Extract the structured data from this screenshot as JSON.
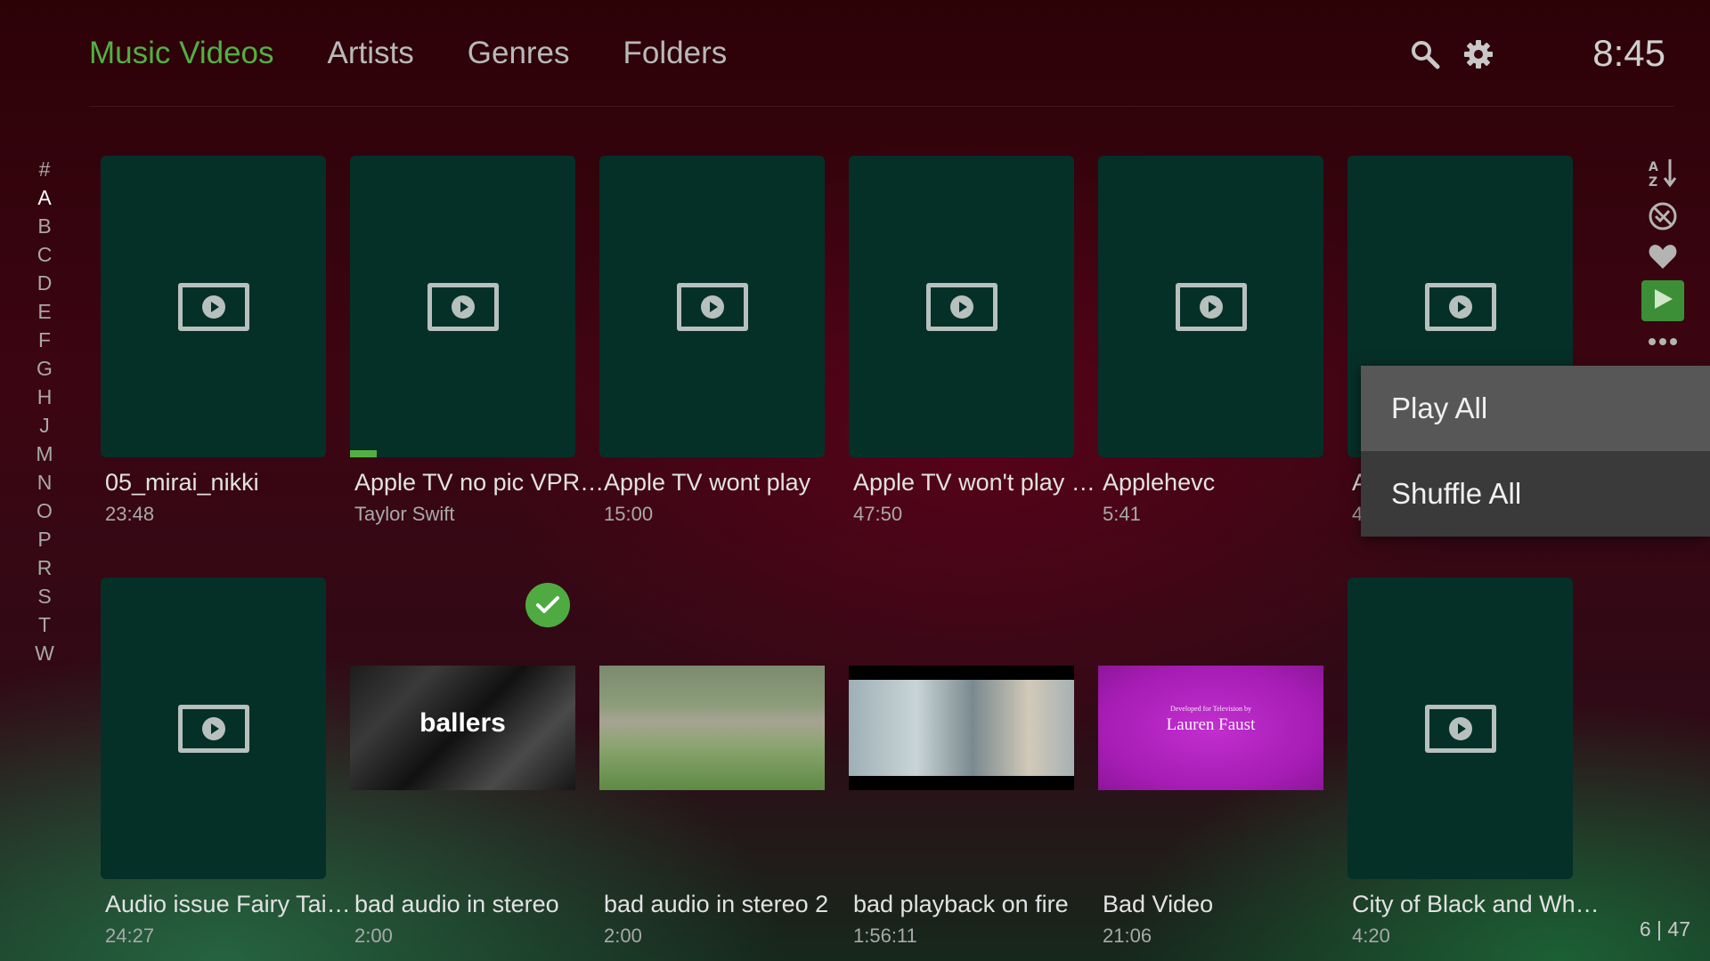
{
  "nav": {
    "tabs": [
      {
        "label": "Music Videos",
        "active": true
      },
      {
        "label": "Artists"
      },
      {
        "label": "Genres"
      },
      {
        "label": "Folders"
      }
    ]
  },
  "header": {
    "clock": "8:45"
  },
  "alphabet": [
    "#",
    "A",
    "B",
    "C",
    "D",
    "E",
    "F",
    "G",
    "H",
    "J",
    "M",
    "N",
    "O",
    "P",
    "R",
    "S",
    "T",
    "W"
  ],
  "alphabet_current": "A",
  "videos": [
    {
      "title": "05_mirai_nikki",
      "subtitle": "23:48"
    },
    {
      "title": "Apple TV no pic VPR…",
      "subtitle": "Taylor Swift",
      "progress": 0.12
    },
    {
      "title": "Apple TV wont play",
      "subtitle": "15:00"
    },
    {
      "title": "Apple TV won't play …",
      "subtitle": "47:50"
    },
    {
      "title": "Applehevc",
      "subtitle": "5:41"
    },
    {
      "title": "A",
      "subtitle": "4"
    },
    {
      "title": "Audio issue Fairy Tai…",
      "subtitle": "24:27"
    },
    {
      "title": "bad audio in stereo",
      "subtitle": "2:00",
      "watched": true,
      "thumbnail_text": "ballers"
    },
    {
      "title": "bad audio in stereo 2",
      "subtitle": "2:00"
    },
    {
      "title": "bad playback on fire",
      "subtitle": "1:56:11"
    },
    {
      "title": "Bad Video",
      "subtitle": "21:06",
      "thumbnail_text_small": "Developed for Television by",
      "thumbnail_text": "Lauren Faust"
    },
    {
      "title": "City of Black and Wh…",
      "subtitle": "4:20"
    }
  ],
  "toolbar": {
    "icons": [
      "sort-az-icon",
      "unwatched-filter-icon",
      "favorite-heart-icon",
      "play-icon",
      "more-icon"
    ]
  },
  "context_menu": {
    "items": [
      {
        "label": "Play All",
        "focused": true
      },
      {
        "label": "Shuffle All"
      }
    ]
  },
  "page_count": "6 | 47",
  "colors": {
    "accent": "#52b043",
    "card_bg": "#053028",
    "menu_bg": "#3a3a3a",
    "menu_focus": "#575757"
  }
}
